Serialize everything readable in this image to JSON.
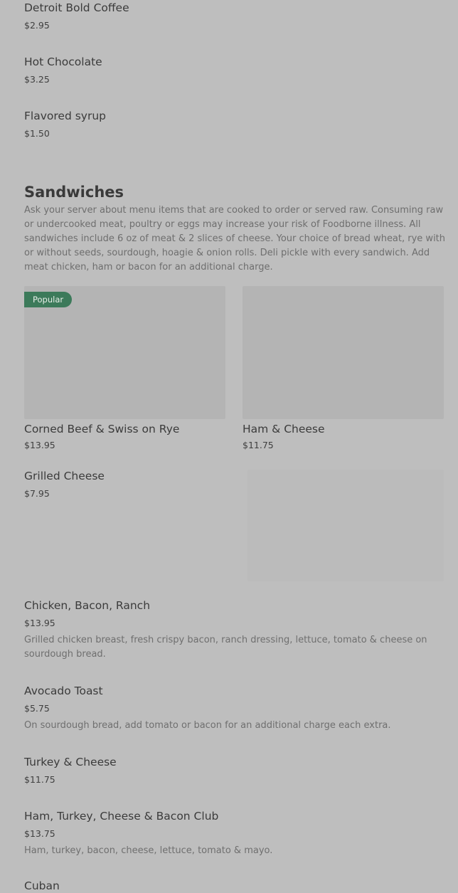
{
  "drinks": [
    {
      "name": "Detroit Bold Coffee",
      "price": "$2.95"
    },
    {
      "name": "Hot Chocolate",
      "price": "$3.25"
    },
    {
      "name": "Flavored syrup",
      "price": "$1.50"
    }
  ],
  "sandwiches": {
    "title": "Sandwiches",
    "description": "Ask your server about menu items that are cooked to order or served raw. Consuming raw or undercooked meat, poultry or eggs may increase your risk of Foodborne illness. All sandwiches include 6 oz of meat & 2 slices of cheese. Your choice of bread wheat, rye with or without seeds, sourdough, hoagie & onion rolls. Deli pickle with every sandwich. Add meat chicken, ham or bacon for an additional charge.",
    "featured": [
      {
        "name": "Corned Beef & Swiss on Rye",
        "price": "$13.95",
        "badge": "Popular"
      },
      {
        "name": "Ham & Cheese",
        "price": "$11.75",
        "badge": ""
      }
    ],
    "grilled_cheese": {
      "name": "Grilled Cheese",
      "price": "$7.95"
    },
    "items": [
      {
        "name": "Chicken, Bacon, Ranch",
        "price": "$13.95",
        "description": "Grilled chicken breast, fresh crispy bacon, ranch dressing, lettuce, tomato & cheese on sourdough bread."
      },
      {
        "name": "Avocado Toast",
        "price": "$5.75",
        "description": "On sourdough bread, add tomato or bacon for an additional charge each extra."
      },
      {
        "name": "Turkey & Cheese",
        "price": "$11.75",
        "description": ""
      },
      {
        "name": "Ham, Turkey, Cheese & Bacon Club",
        "price": "$13.75",
        "description": "Ham, turkey, bacon, cheese, lettuce, tomato & mayo."
      },
      {
        "name": "Cuban",
        "price": "",
        "description": ""
      }
    ]
  },
  "colors": {
    "background": "#bebebe",
    "badge": "#3c7a5a",
    "image_placeholder": "#b4b4b4"
  }
}
